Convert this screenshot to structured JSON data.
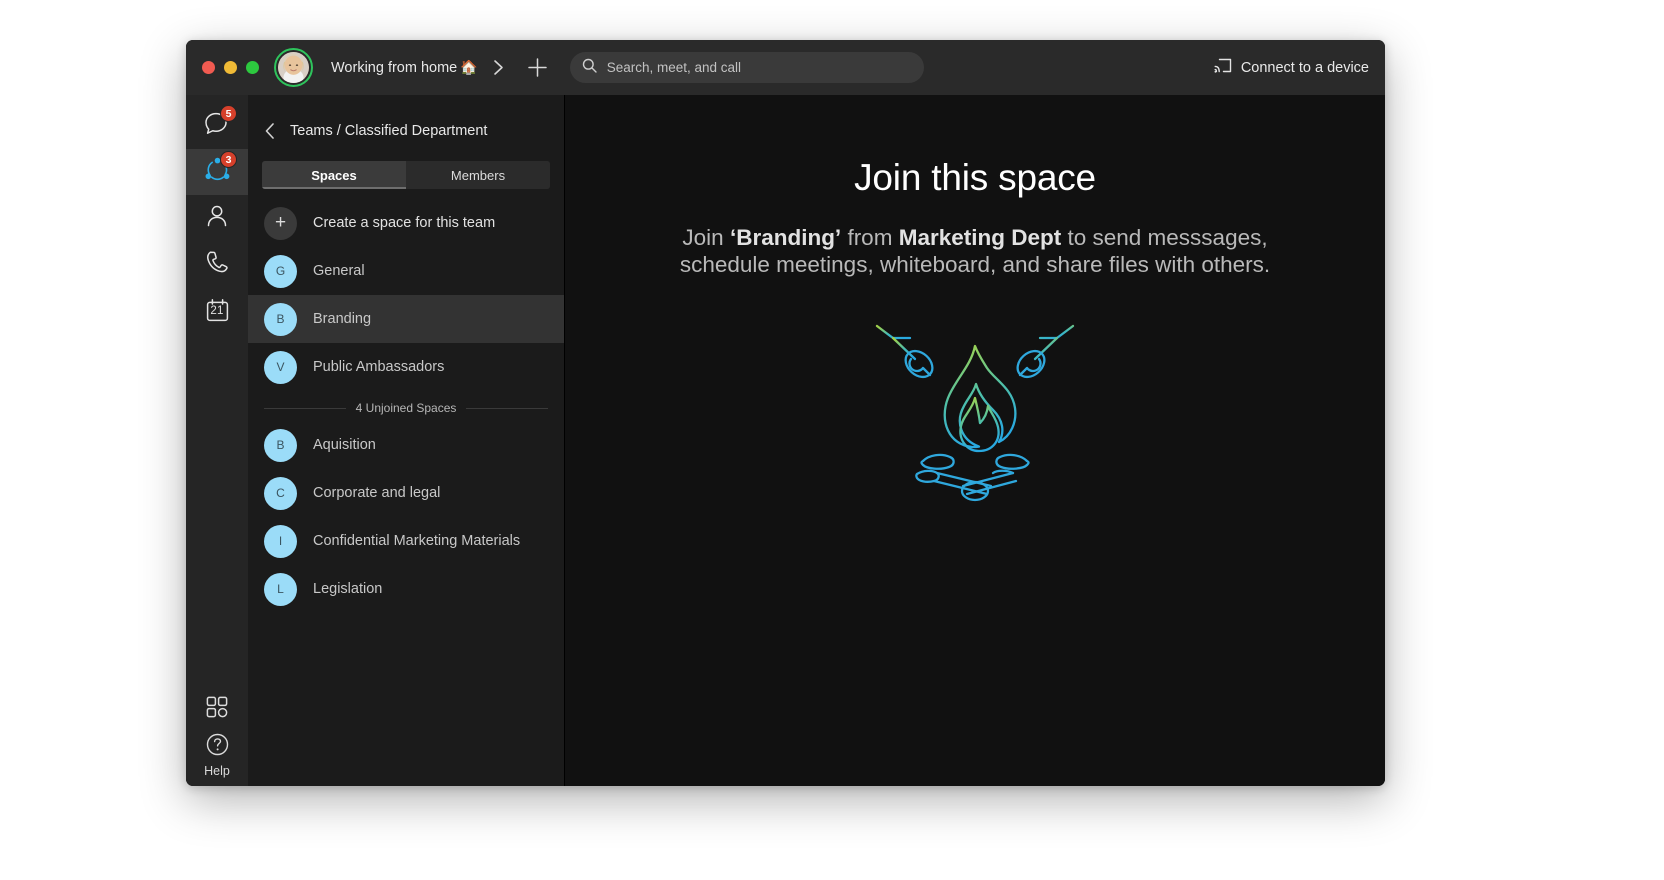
{
  "window": {
    "traffic_lights": [
      "close",
      "minimize",
      "zoom"
    ],
    "status_text": "Working from home",
    "status_emoji": "🏠",
    "search": {
      "placeholder": "Search, meet, and call",
      "value": ""
    },
    "connect_label": "Connect to a device"
  },
  "rail": {
    "items": [
      {
        "name": "messaging",
        "icon": "chat-bubble-icon",
        "badge": "5",
        "active": false
      },
      {
        "name": "teams",
        "icon": "teams-icon",
        "badge": "3",
        "active": true
      },
      {
        "name": "contacts",
        "icon": "person-icon",
        "badge": "",
        "active": false
      },
      {
        "name": "calling",
        "icon": "phone-icon",
        "badge": "",
        "active": false
      },
      {
        "name": "meetings",
        "icon": "calendar-icon",
        "badge": "",
        "active": false,
        "day": "21"
      }
    ],
    "apps_icon": "apps-grid-icon",
    "help_icon": "question-circle-icon",
    "help_label": "Help"
  },
  "sidebar": {
    "back_icon": "chevron-left-icon",
    "breadcrumb": "Teams / Classified Department",
    "tabs": [
      {
        "label": "Spaces",
        "active": true
      },
      {
        "label": "Members",
        "active": false
      }
    ],
    "create_space_label": "Create a space for this team",
    "create_space_icon": "plus-icon",
    "joined_spaces": [
      {
        "initial": "G",
        "label": "General",
        "selected": false
      },
      {
        "initial": "B",
        "label": "Branding",
        "selected": true
      },
      {
        "initial": "V",
        "label": "Public Ambassadors",
        "selected": false
      }
    ],
    "unjoined_divider": "4 Unjoined Spaces",
    "unjoined_spaces": [
      {
        "initial": "B",
        "label": "Aquisition",
        "selected": false
      },
      {
        "initial": "C",
        "label": "Corporate and legal",
        "selected": false
      },
      {
        "initial": "I",
        "label": "Confidential Marketing Materials",
        "selected": false
      },
      {
        "initial": "L",
        "label": "Legislation",
        "selected": false
      }
    ]
  },
  "main": {
    "title": "Join this space",
    "subtitle_part1": "Join ",
    "subtitle_space": "‘Branding’",
    "subtitle_part2": " from ",
    "subtitle_team": "Marketing Dept",
    "subtitle_part3": " to send messsages, schedule meetings, whiteboard, and share files with others.",
    "illustration": "campfire-marshmallows-illustration"
  },
  "colors": {
    "accent_blue": "#9bdcf8",
    "badge_red": "#d6402b",
    "window_bg": "#111111",
    "titlebar_bg": "#2a2a2a",
    "sidebar_bg": "#1b1b1b",
    "rail_bg": "#252525",
    "illo_green": "#a8d545",
    "illo_blue": "#29a9e0",
    "presence_green": "#2ec45c"
  }
}
